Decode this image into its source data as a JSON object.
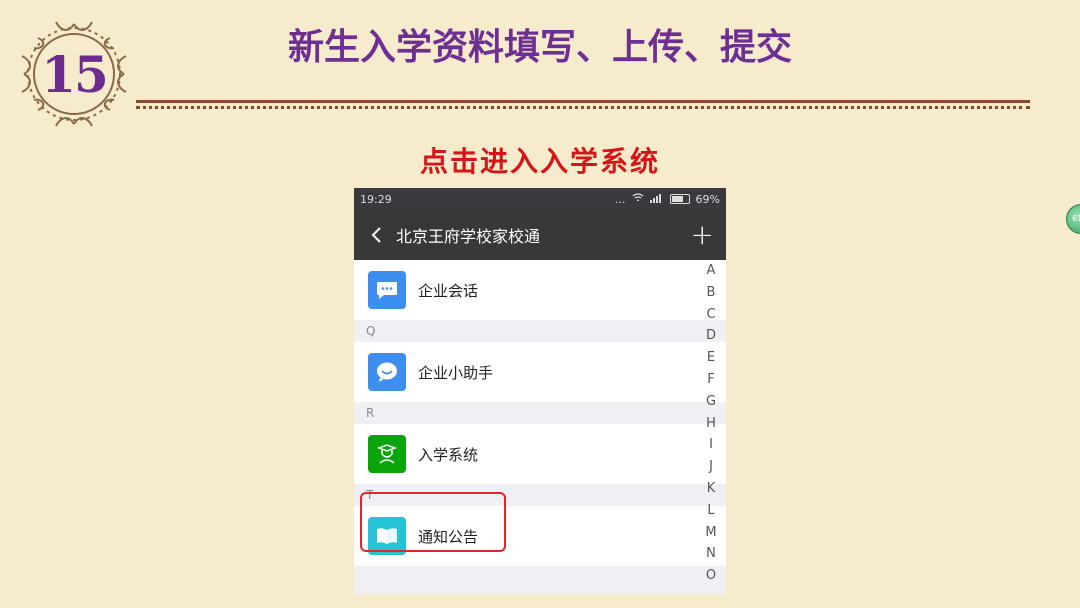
{
  "slide": {
    "number": "15",
    "title": "新生入学资料填写、上传、提交",
    "subtitle": "点击进入入学系统"
  },
  "side_badge": "61",
  "phone": {
    "status": {
      "time": "19:29",
      "signal_text": "...",
      "battery": "69%"
    },
    "nav": {
      "title": "北京王府学校家校通",
      "back_icon": "chevron-left-icon",
      "add_icon": "plus-icon",
      "add_label": "+"
    },
    "rows": [
      {
        "label": "企业会话",
        "icon": "chat-bubble-icon",
        "color": "#3e8ef0"
      },
      {
        "section": "Q"
      },
      {
        "label": "企业小助手",
        "icon": "smile-bubble-icon",
        "color": "#3e8ef0"
      },
      {
        "section": "R"
      },
      {
        "label": "入学系统",
        "icon": "graduate-icon",
        "color": "#0aa50a"
      },
      {
        "section": "T"
      },
      {
        "label": "通知公告",
        "icon": "book-icon",
        "color": "#25c2d8"
      }
    ],
    "index_letters": [
      "A",
      "B",
      "C",
      "D",
      "E",
      "F",
      "G",
      "H",
      "I",
      "J",
      "K",
      "L",
      "M",
      "N",
      "O"
    ]
  },
  "colors": {
    "background": "#f6ebcd",
    "title": "#6e2f93",
    "subtitle": "#d61616",
    "highlight": "#e0262a"
  }
}
